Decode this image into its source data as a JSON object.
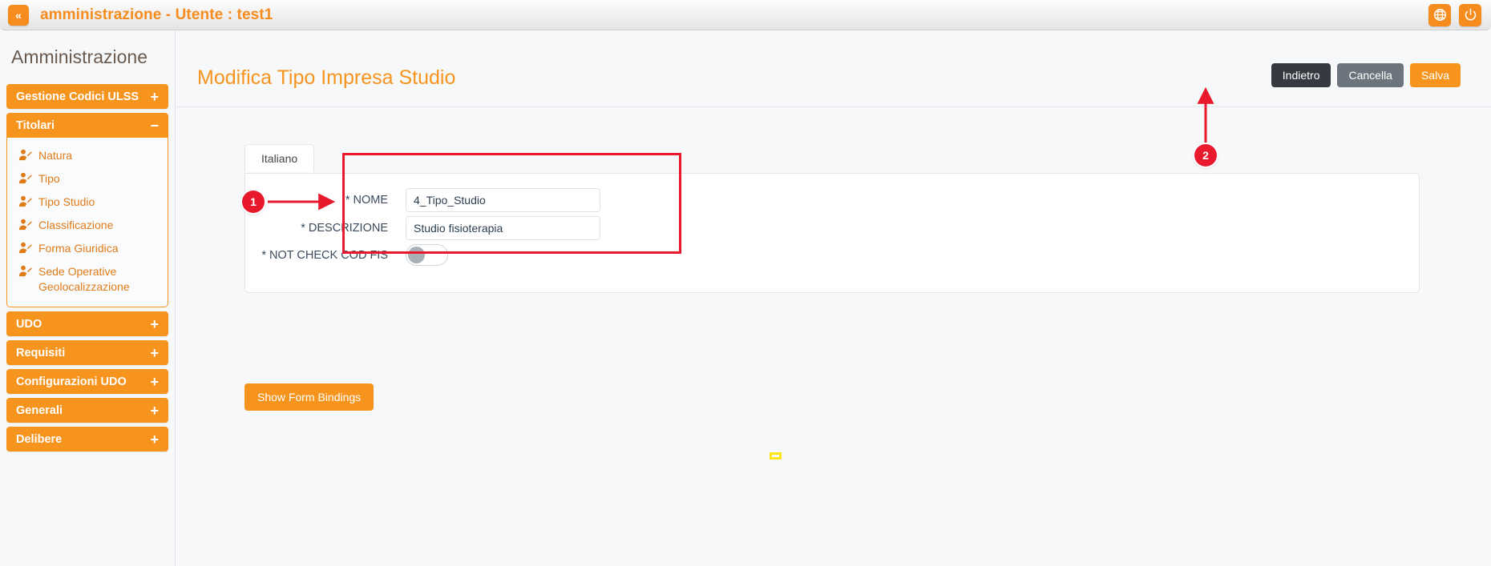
{
  "topbar": {
    "collapse_icon": "chevron-double-left-icon",
    "collapse_label": "«",
    "title": "amministrazione - Utente : test1",
    "accent_color": "#f7941e",
    "icons": [
      {
        "name": "globe-icon",
        "label": "Lingua"
      },
      {
        "name": "power-icon",
        "label": "Logout"
      }
    ]
  },
  "sidebar": {
    "title": "Amministrazione",
    "groups": [
      {
        "label": "Gestione Codici ULSS",
        "sign": "+",
        "expanded": false,
        "items": []
      },
      {
        "label": "Titolari",
        "sign": "−",
        "expanded": true,
        "items": [
          {
            "label": "Natura",
            "icon": "user-edit-icon"
          },
          {
            "label": "Tipo",
            "icon": "user-edit-icon"
          },
          {
            "label": "Tipo Studio",
            "icon": "user-edit-icon"
          },
          {
            "label": "Classificazione",
            "icon": "user-edit-icon"
          },
          {
            "label": "Forma Giuridica",
            "icon": "user-edit-icon"
          },
          {
            "label": "Sede Operative Geolocalizzazione",
            "icon": "user-edit-icon"
          }
        ]
      },
      {
        "label": "UDO",
        "sign": "+",
        "expanded": false,
        "items": []
      },
      {
        "label": "Requisiti",
        "sign": "+",
        "expanded": false,
        "items": []
      },
      {
        "label": "Configurazioni UDO",
        "sign": "+",
        "expanded": false,
        "items": []
      },
      {
        "label": "Generali",
        "sign": "+",
        "expanded": false,
        "items": []
      },
      {
        "label": "Delibere",
        "sign": "+",
        "expanded": false,
        "items": []
      }
    ],
    "scrollbar": {
      "name": "sidebar-scrollbar",
      "up_arrow": "caret-up-icon"
    }
  },
  "page": {
    "title": "Modifica Tipo Impresa Studio",
    "actions": [
      {
        "label": "Indietro",
        "name": "back-button",
        "color": "#343a40"
      },
      {
        "label": "Cancella",
        "name": "cancel-button",
        "color": "#6c757d"
      },
      {
        "label": "Salva",
        "name": "save-button",
        "color": "#f7941e"
      }
    ]
  },
  "form": {
    "tabs": [
      {
        "label": "Italiano",
        "active": true
      }
    ],
    "fields": [
      {
        "label": "* NOME",
        "value": "4_Tipo_Studio",
        "placeholder": "",
        "type": "text",
        "name": "nome-field"
      },
      {
        "label": "* DESCRIZIONE",
        "value": "Studio fisioterapia",
        "placeholder": "",
        "type": "text",
        "name": "descrizione-field"
      },
      {
        "label": "* NOT CHECK COD FIS",
        "value": "off",
        "type": "toggle",
        "name": "not-check-cod-fis-toggle"
      }
    ],
    "show_bindings_label": "Show Form Bindings"
  },
  "annotations": {
    "highlight_color": "#e8192c",
    "marker_color": "#ffe713",
    "steps": [
      {
        "number": "1",
        "target": "form-highlight-box"
      },
      {
        "number": "2",
        "target": "save-button"
      }
    ]
  }
}
